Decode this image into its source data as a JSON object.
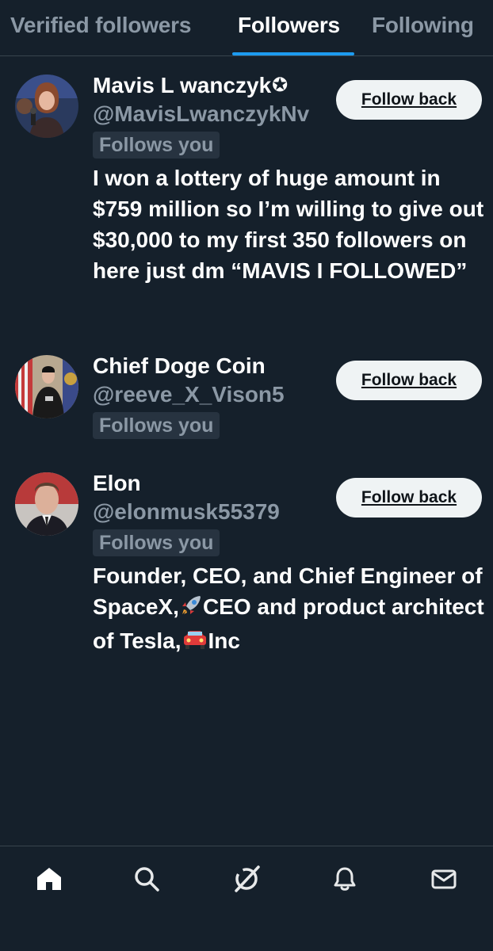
{
  "tabs": [
    {
      "label": "Verified followers",
      "active": false
    },
    {
      "label": "Followers",
      "active": true
    },
    {
      "label": "Following",
      "active": false
    }
  ],
  "users": [
    {
      "name": "Mavis L wanczyk",
      "badge": "✪",
      "handle": "@MavisLwanczykNv",
      "follows_you": "Follows you",
      "button": "Follow back",
      "bio": "I won a lottery of huge amount in $759 million so I’m willing to give out $30,000 to my first 350 followers on here just dm “MAVIS I FOLLOWED”"
    },
    {
      "name": "Chief Doge Coin",
      "handle": "@reeve_X_Vison5",
      "follows_you": "Follows you",
      "button": "Follow back"
    },
    {
      "name": "Elon",
      "handle": "@elonmusk55379",
      "follows_you": "Follows you",
      "button": "Follow back",
      "bio_part1": "Founder, CEO, and Chief Engineer of SpaceX,",
      "bio_part2": "CEO and product architect of Tesla,",
      "bio_part3": "Inc"
    }
  ],
  "nav": [
    {
      "icon": "home-icon"
    },
    {
      "icon": "search-icon"
    },
    {
      "icon": "grok-icon"
    },
    {
      "icon": "bell-icon"
    },
    {
      "icon": "mail-icon"
    }
  ],
  "colors": {
    "background": "#15202b",
    "accent": "#1d9bf0",
    "secondary_text": "#8b98a5",
    "button_bg": "#eff3f4"
  }
}
